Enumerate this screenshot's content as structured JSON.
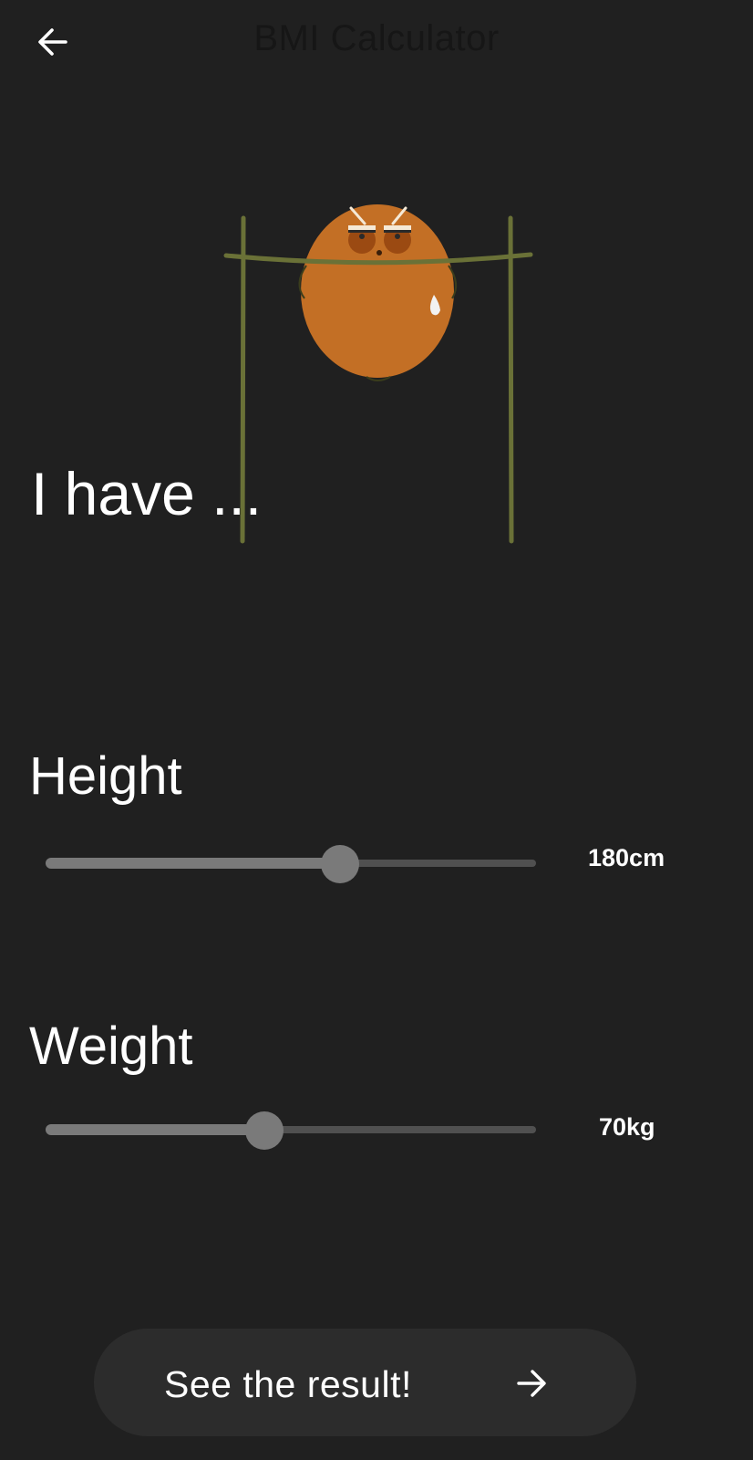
{
  "app_bar": {
    "title": "BMI Calculator",
    "back_icon": "arrow-left-icon"
  },
  "illustration": {
    "name": "pull-up-character",
    "colors": {
      "body": "#C36F25",
      "bar": "#6A7137",
      "eyes": "#9B4A12"
    }
  },
  "heading": "I have ...",
  "height": {
    "label": "Height",
    "value_text": "180cm",
    "fraction": 0.6
  },
  "weight": {
    "label": "Weight",
    "value_text": "70kg",
    "fraction": 0.447
  },
  "result_button": {
    "label": "See the result!",
    "icon": "arrow-right-icon"
  },
  "colors": {
    "background": "#202020",
    "button": "#2C2C2C",
    "slider_active": "#7A7A7A",
    "slider_inactive": "#505050",
    "text": "#FFFFFF"
  }
}
